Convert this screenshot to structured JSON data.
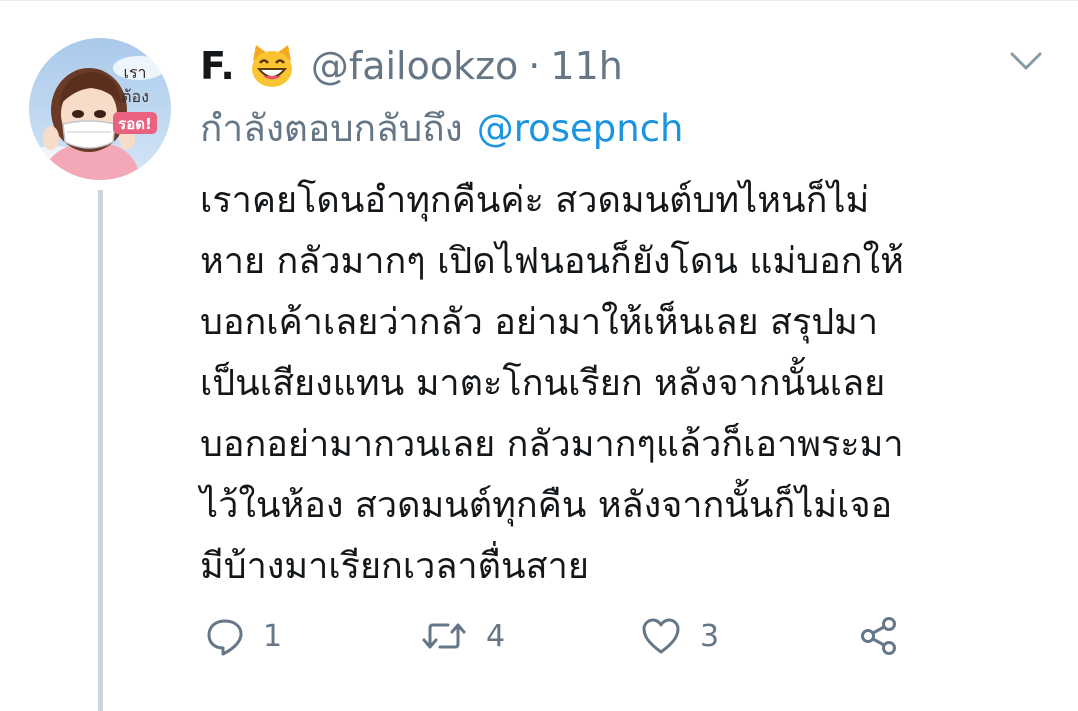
{
  "tweet": {
    "display_name": "F.",
    "name_emoji": "grinning-cat-face-icon",
    "handle": "@failookzo",
    "separator": "·",
    "time": "11h",
    "reply_prefix": "กำลังตอบกลับถึง",
    "reply_mention": "@rosepnch",
    "text_lines": [
      "เราคยโดนอำทุกคืนค่ะ สวดมนต์บทไหนก็ไม่",
      "หาย กลัวมากๆ เปิดไฟนอนก็ยังโดน แม่บอกให้",
      "บอกเค้าเลยว่ากลัว อย่ามาให้เห็นเลย สรุปมา",
      "เป็นเสียงแทน มาตะโกนเรียก หลังจากนั้นเลย",
      "บอกอย่ามากวนเลย กลัวมากๆแล้วก็เอาพระมา",
      "ไว้ในห้อง สวดมนต์ทุกคืน หลังจากนั้นก็ไม่เจอ",
      "มีบ้างมาเรียกเวลาตื่นสาย"
    ]
  },
  "avatar": {
    "badge_lines": [
      "เรา",
      "ต้อง",
      "รอด!"
    ]
  },
  "actions": {
    "reply_count": "1",
    "retweet_count": "4",
    "like_count": "3"
  },
  "icons": {
    "caret": "chevron-down-icon",
    "reply": "reply-bubble-icon",
    "retweet": "retweet-icon",
    "like": "heart-icon",
    "share": "share-icon"
  },
  "colors": {
    "text": "#14171a",
    "secondary": "#657786",
    "link": "#1b95e0",
    "thread_line": "#ccd6dd"
  }
}
